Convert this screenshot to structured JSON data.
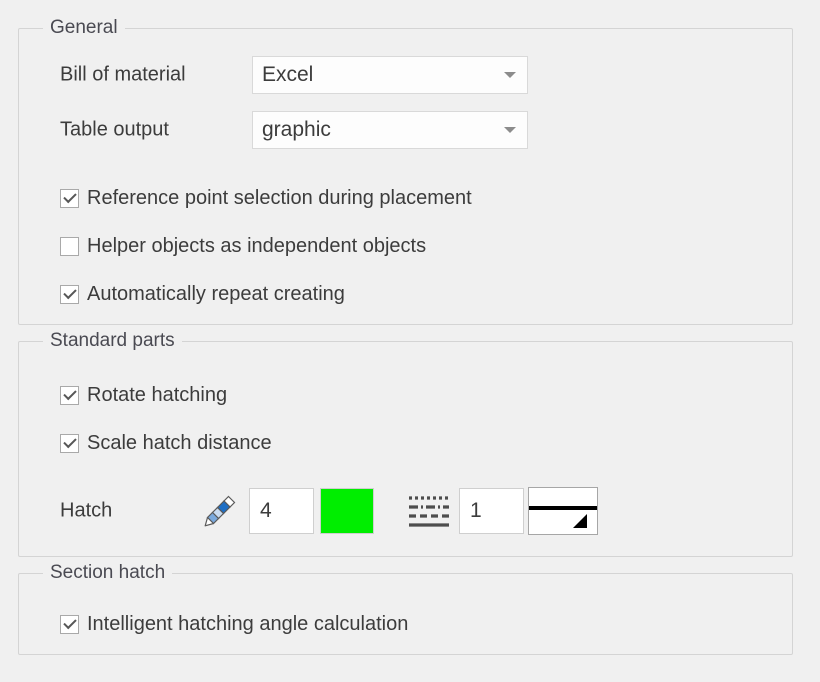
{
  "groups": {
    "general": {
      "title": "General",
      "fields": [
        {
          "label": "Bill of material",
          "value": "Excel"
        },
        {
          "label": "Table output",
          "value": "graphic"
        }
      ],
      "checkboxes": [
        {
          "label": "Reference point selection during placement",
          "checked": true
        },
        {
          "label": "Helper objects as independent objects",
          "checked": false
        },
        {
          "label": "Automatically repeat creating",
          "checked": true
        }
      ]
    },
    "standard_parts": {
      "title": "Standard parts",
      "checkboxes": [
        {
          "label": "Rotate hatching",
          "checked": true
        },
        {
          "label": "Scale hatch distance",
          "checked": true
        }
      ],
      "hatch": {
        "label": "Hatch",
        "pencil_icon": "pencil-icon",
        "count_value": "4",
        "color": "#00ee00",
        "linetype_icon": "line-type-icon",
        "scale_value": "1",
        "lineweight_icon": "line-weight-box"
      }
    },
    "section_hatch": {
      "title": "Section hatch",
      "checkboxes": [
        {
          "label": "Intelligent hatching angle calculation",
          "checked": true
        }
      ]
    }
  }
}
